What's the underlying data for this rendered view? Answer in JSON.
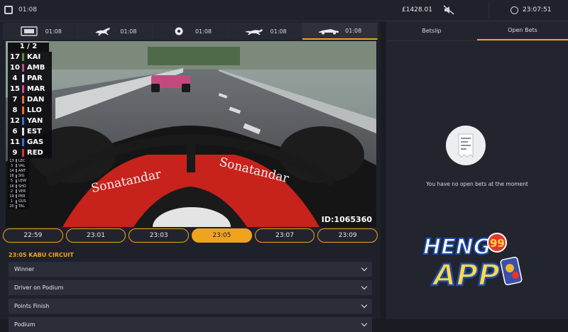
{
  "topbar": {
    "time": "01:08",
    "balance": "£1428.01",
    "clock": "23:07:51"
  },
  "tabs": [
    {
      "time": "01:08",
      "icon": "tv-icon"
    },
    {
      "time": "01:08",
      "icon": "horse-icon"
    },
    {
      "time": "01:08",
      "icon": "football-icon"
    },
    {
      "time": "01:08",
      "icon": "greyhound-icon"
    },
    {
      "time": "01:08",
      "icon": "race-car-icon",
      "active": true
    }
  ],
  "video": {
    "lap": "1 / 2",
    "id_label": "ID:1065360",
    "sponsor": "Sonatandar",
    "standings": [
      {
        "pos": "17",
        "code": "KAI",
        "color": "#5b8f3a"
      },
      {
        "pos": "10",
        "code": "AMB",
        "color": "#c04b8f"
      },
      {
        "pos": "4",
        "code": "PAR",
        "color": "#e0e0e0"
      },
      {
        "pos": "15",
        "code": "MAR",
        "color": "#d24aa0"
      },
      {
        "pos": "7",
        "code": "DAN",
        "color": "#e0742a"
      },
      {
        "pos": "8",
        "code": "LLO",
        "color": "#e0742a"
      },
      {
        "pos": "12",
        "code": "YAN",
        "color": "#3a6fd0"
      },
      {
        "pos": "6",
        "code": "EST",
        "color": "#e0e0e0"
      },
      {
        "pos": "11",
        "code": "GAS",
        "color": "#3a6fd0"
      },
      {
        "pos": "9",
        "code": "RED",
        "color": "#d03a3a"
      }
    ],
    "mini_standings": [
      {
        "pos": "13",
        "code": "LEC"
      },
      {
        "pos": "3",
        "code": "VAL"
      },
      {
        "pos": "14",
        "code": "ANT"
      },
      {
        "pos": "18",
        "code": "SIG"
      },
      {
        "pos": "5",
        "code": "LEW"
      },
      {
        "pos": "16",
        "code": "SHO"
      },
      {
        "pos": "2",
        "code": "VER"
      },
      {
        "pos": "19",
        "code": "PER"
      },
      {
        "pos": "1",
        "code": "GUS"
      },
      {
        "pos": "20",
        "code": "TAL"
      }
    ]
  },
  "times": [
    "22:59",
    "23:01",
    "23:03",
    "23:05",
    "23:07",
    "23:09"
  ],
  "active_time_index": 3,
  "race_title": "23:05 KABU CIRCUIT",
  "markets": [
    "Winner",
    "Driver on Podium",
    "Points Finish",
    "Podium"
  ],
  "betslip": {
    "tabs": [
      "Betslip",
      "Open Bets"
    ],
    "active_tab": 1,
    "empty_message": "You have no open bets at the moment"
  },
  "logo": {
    "line1": "HENG",
    "line2": "APP",
    "badge": "99"
  },
  "colors": {
    "accent": "#f0a41e",
    "panel": "#1f212a",
    "row": "#2b2e39"
  }
}
